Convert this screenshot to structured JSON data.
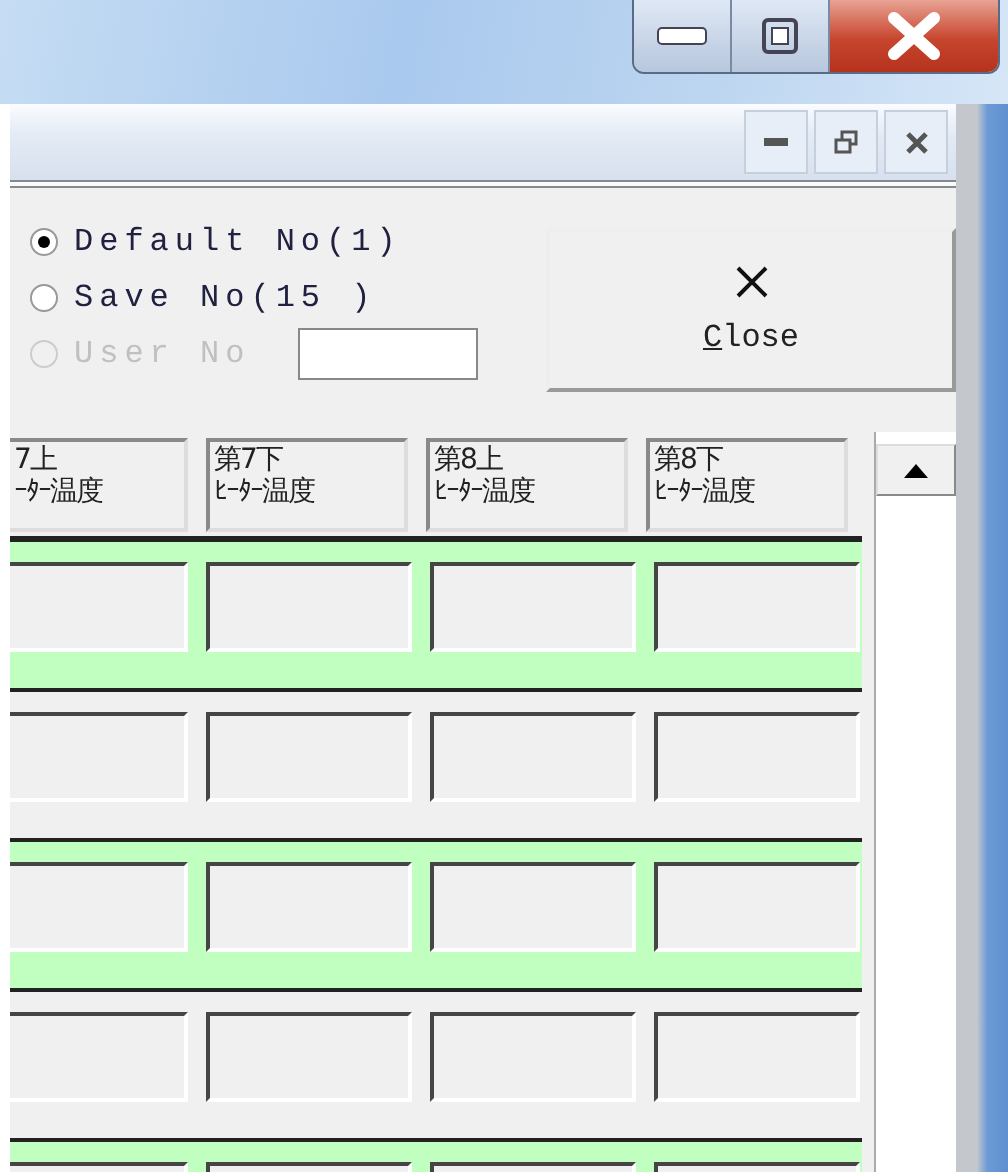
{
  "options": [
    {
      "label": "Default No(1)",
      "selected": true,
      "disabled": false
    },
    {
      "label": "Save No(15 )",
      "selected": false,
      "disabled": false
    },
    {
      "label": "User No",
      "selected": false,
      "disabled": true
    }
  ],
  "close_button": {
    "label": "Close"
  },
  "columns": [
    {
      "line1": "7上",
      "line2": "ｰﾀｰ温度"
    },
    {
      "line1": "第7下",
      "line2": "ﾋｰﾀｰ温度"
    },
    {
      "line1": "第8上",
      "line2": "ﾋｰﾀｰ温度"
    },
    {
      "line1": "第8下",
      "line2": "ﾋｰﾀｰ温度"
    }
  ],
  "rows": [
    {
      "highlighted": true
    },
    {
      "highlighted": false
    },
    {
      "highlighted": true
    },
    {
      "highlighted": false
    },
    {
      "highlighted": true
    }
  ]
}
